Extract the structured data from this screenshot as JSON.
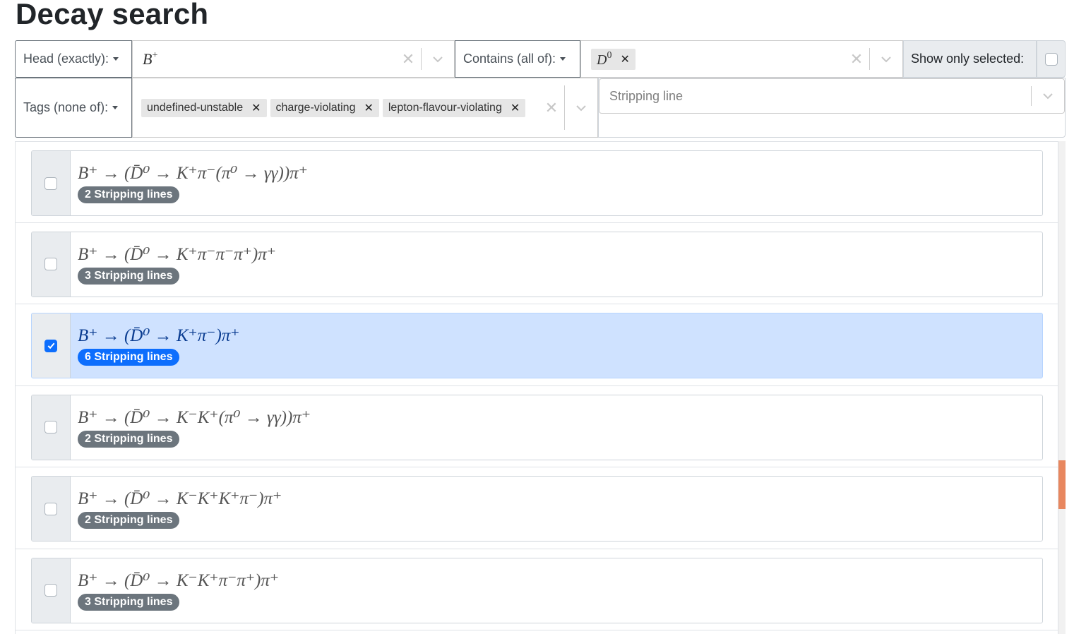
{
  "page_title": "Decay search",
  "head_filter": {
    "mode_label": "Head (exactly):",
    "value": "B",
    "value_sup": "+"
  },
  "contains_filter": {
    "mode_label": "Contains (all of):",
    "chip": "D",
    "chip_sup": "0"
  },
  "show_only_selected": {
    "label": "Show only selected:",
    "checked": false
  },
  "tags_filter": {
    "mode_label": "Tags (none of):",
    "chips": [
      "undefined-unstable",
      "charge-violating",
      "lepton-flavour-violating"
    ]
  },
  "stripping_line": {
    "placeholder": "Stripping line"
  },
  "decays": [
    {
      "expr": "B⁺ → (D̄⁰ → K⁺π⁻(π⁰ → γγ))π⁺",
      "badge": "2 Stripping lines",
      "selected": false
    },
    {
      "expr": "B⁺ → (D̄⁰ → K⁺π⁻π⁻π⁺)π⁺",
      "badge": "3 Stripping lines",
      "selected": false
    },
    {
      "expr": "B⁺ → (D̄⁰ → K⁺π⁻)π⁺",
      "badge": "6 Stripping lines",
      "selected": true
    },
    {
      "expr": "B⁺ → (D̄⁰ → K⁻K⁺(π⁰ → γγ))π⁺",
      "badge": "2 Stripping lines",
      "selected": false
    },
    {
      "expr": "B⁺ → (D̄⁰ → K⁻K⁺K⁺π⁻)π⁺",
      "badge": "2 Stripping lines",
      "selected": false
    },
    {
      "expr": "B⁺ → (D̄⁰ → K⁻K⁺π⁻π⁺)π⁺",
      "badge": "3 Stripping lines",
      "selected": false
    }
  ],
  "colors": {
    "selected_bg": "#cfe2ff",
    "accent": "#0d6efd",
    "badge_gray": "#6c757d",
    "scroll_thumb": "#e8875f"
  },
  "icons": {
    "clear": "x-icon",
    "dropdown": "chevron-down-icon",
    "check": "check-icon"
  }
}
